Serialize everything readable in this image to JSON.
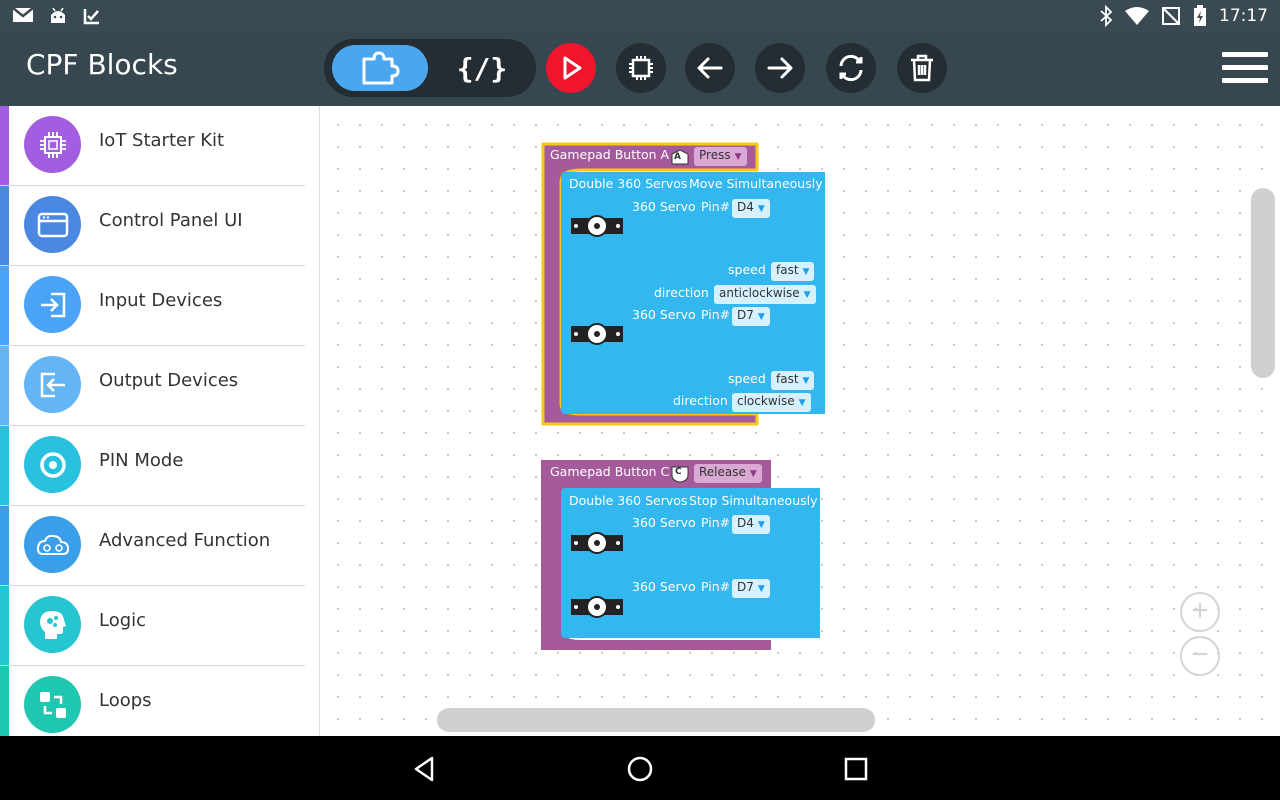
{
  "status_bar": {
    "time": "17:17"
  },
  "toolbar": {
    "title": "CPF Blocks",
    "code_label": "{/}"
  },
  "sidebar": {
    "items": [
      {
        "label": "IoT Starter Kit",
        "color": "#a25de0"
      },
      {
        "label": "Control Panel UI",
        "color": "#4a87e0"
      },
      {
        "label": "Input Devices",
        "color": "#4aa3f5"
      },
      {
        "label": "Output Devices",
        "color": "#64b5f6"
      },
      {
        "label": "PIN Mode",
        "color": "#29c1e0"
      },
      {
        "label": "Advanced Function",
        "color": "#3a9fe8"
      },
      {
        "label": "Logic",
        "color": "#26c6d0"
      },
      {
        "label": "Loops",
        "color": "#1fc7b0"
      }
    ]
  },
  "workspace": {
    "block1": {
      "event_label": "Gamepad Button A",
      "button_letter": "A",
      "action": "Press",
      "servo_title": "Double 360 Servos",
      "servo_mode": "Move Simultaneously",
      "servo1": {
        "label": "360 Servo",
        "pin_label": "Pin#",
        "pin": "D4",
        "speed_label": "speed",
        "speed": "fast",
        "direction_label": "direction",
        "direction": "anticlockwise"
      },
      "servo2": {
        "label": "360 Servo",
        "pin_label": "Pin#",
        "pin": "D7",
        "speed_label": "speed",
        "speed": "fast",
        "direction_label": "direction",
        "direction": "clockwise"
      }
    },
    "block2": {
      "event_label": "Gamepad Button C",
      "button_letter": "C",
      "action": "Release",
      "servo_title": "Double 360 Servos",
      "servo_mode": "Stop Simultaneously",
      "servo1": {
        "label": "360 Servo",
        "pin_label": "Pin#",
        "pin": "D4"
      },
      "servo2": {
        "label": "360 Servo",
        "pin_label": "Pin#",
        "pin": "D7"
      }
    },
    "zoom_in": "+",
    "zoom_out": "−"
  },
  "colors": {
    "event_block": "#a55b9b",
    "servo_block": "#32b7ef",
    "selected_outline": "#f6c915",
    "run_button": "#f0142d",
    "toolbar": "#37474f"
  }
}
